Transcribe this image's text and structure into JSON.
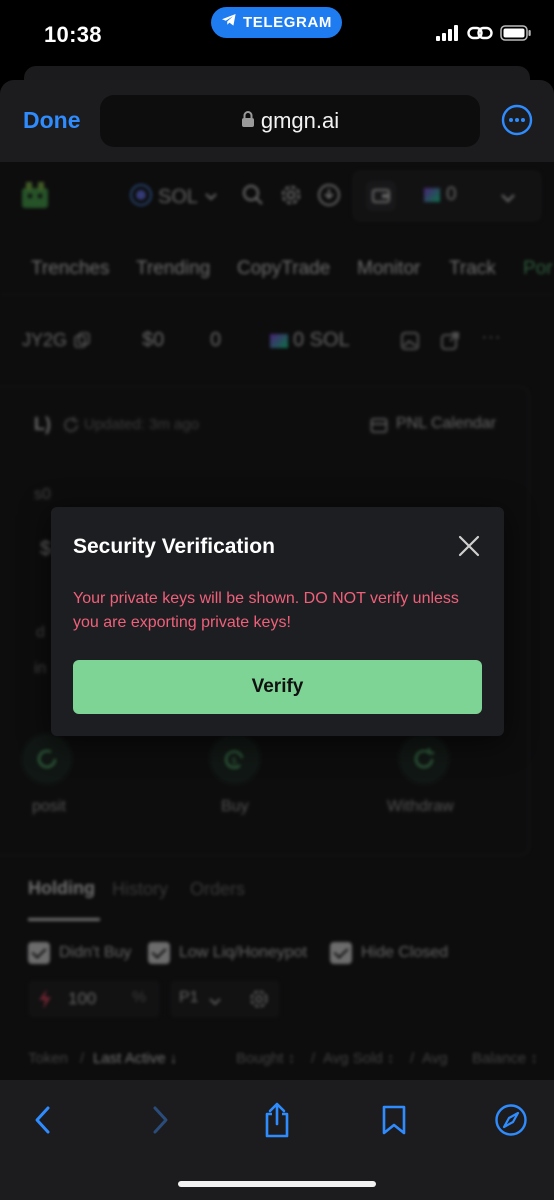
{
  "status_bar": {
    "time": "10:38",
    "app_pill_label": "TELEGRAM",
    "icons": [
      "telegram-icon",
      "signal-icon",
      "link-icon",
      "battery-icon"
    ]
  },
  "browser": {
    "done_label": "Done",
    "url": "gmgn.ai",
    "icons": [
      "lock-icon",
      "more-icon",
      "back-icon",
      "forward-icon",
      "share-icon",
      "bookmarks-icon",
      "compass-icon"
    ]
  },
  "background_page": {
    "chain": "SOL",
    "wallet_count": "0",
    "nav_tabs": [
      "Trenches",
      "Trending",
      "CopyTrade",
      "Monitor",
      "Track",
      "Por"
    ],
    "wallet_row": {
      "address_fragment": "JY2G",
      "usd_value": "$0",
      "count": "0",
      "sol_balance": "0 SOL"
    },
    "pnl_row": {
      "label_fragment": "L)",
      "updated": "Updated: 3m ago",
      "calendar_label": "PNL Calendar"
    },
    "left_fragments": [
      "s0",
      "$",
      "d",
      "in"
    ],
    "actions": [
      "posit",
      "Buy",
      "Withdraw"
    ],
    "tabs": [
      "Holding",
      "History",
      "Orders"
    ],
    "filters": [
      "Didn't Buy",
      "Low Liq/Honeypot",
      "Hide Closed"
    ],
    "buy_amount": "100",
    "percent_symbol": "%",
    "preset": "P1",
    "table_headers": [
      "Token",
      "/",
      "Last Active ↓",
      "Bought ↕",
      "/",
      "Avg Sold ↕",
      "/",
      "Avg",
      "Balance ↕"
    ]
  },
  "modal": {
    "title": "Security Verification",
    "message": "Your private keys will be shown. DO NOT verify unless you are exporting private keys!",
    "verify_label": "Verify"
  },
  "colors": {
    "accent_blue": "#2f8cff",
    "telegram_blue": "#1e7cf0",
    "warning_pink": "#f0607a",
    "verify_green": "#7ed495",
    "modal_bg": "#1d1e21"
  }
}
